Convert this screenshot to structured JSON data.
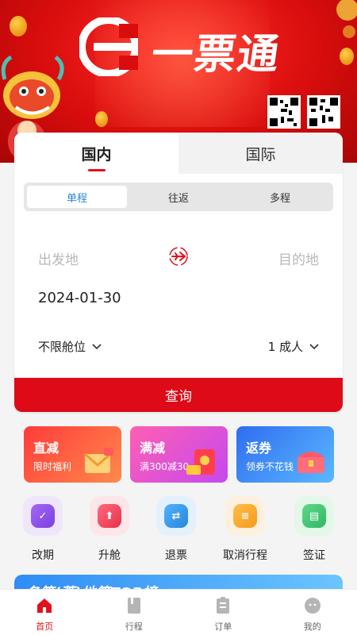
{
  "hero": {
    "brand_title": "一票通",
    "logo_letter": "E",
    "colors": {
      "primary": "#de0a17",
      "accent": "#2a86d8"
    }
  },
  "search": {
    "tabs": [
      {
        "label": "国内",
        "active": true
      },
      {
        "label": "国际",
        "active": false
      }
    ],
    "trip_types": [
      {
        "label": "单程",
        "active": true
      },
      {
        "label": "往返",
        "active": false
      },
      {
        "label": "多程",
        "active": false
      }
    ],
    "departure_placeholder": "出发地",
    "arrival_placeholder": "目的地",
    "date": "2024-01-30",
    "cabin": "不限舱位",
    "passengers": "1 成人",
    "search_label": "查询"
  },
  "promos": [
    {
      "title": "直减",
      "subtitle": "限时福利"
    },
    {
      "title": "满减",
      "subtitle": "满300减30"
    },
    {
      "title": "返券",
      "subtitle": "领券不花钱"
    }
  ],
  "services": [
    {
      "label": "改期",
      "icon": "reschedule-icon"
    },
    {
      "label": "升舱",
      "icon": "upgrade-icon"
    },
    {
      "label": "退票",
      "icon": "refund-icon"
    },
    {
      "label": "取消行程",
      "icon": "cancel-trip-icon"
    },
    {
      "label": "签证",
      "icon": "visa-icon"
    }
  ],
  "ranking_banner": "各第(蒂)地第TOP榜",
  "nav": [
    {
      "label": "首页",
      "icon": "home-icon",
      "active": true
    },
    {
      "label": "行程",
      "icon": "itinerary-icon",
      "active": false
    },
    {
      "label": "订单",
      "icon": "orders-icon",
      "active": false
    },
    {
      "label": "我的",
      "icon": "profile-icon",
      "active": false
    }
  ]
}
